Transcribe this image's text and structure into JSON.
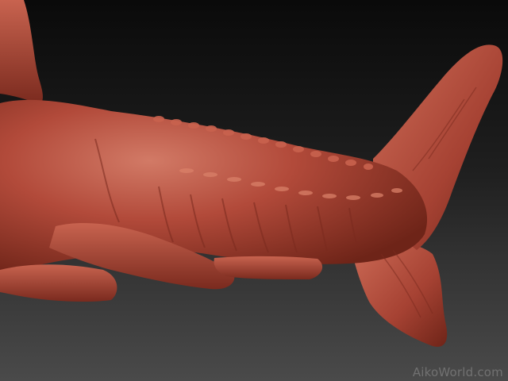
{
  "scene": {
    "subject": "sculpted-sea-creature-tail",
    "colors": {
      "background_top": "#0a0a0a",
      "background_bottom": "#4a4a4a",
      "clay": "#b24a3a",
      "clay_highlight": "#d27a66",
      "clay_shadow": "#6e2418"
    }
  },
  "watermark": {
    "text": "AikoWorld.com"
  }
}
